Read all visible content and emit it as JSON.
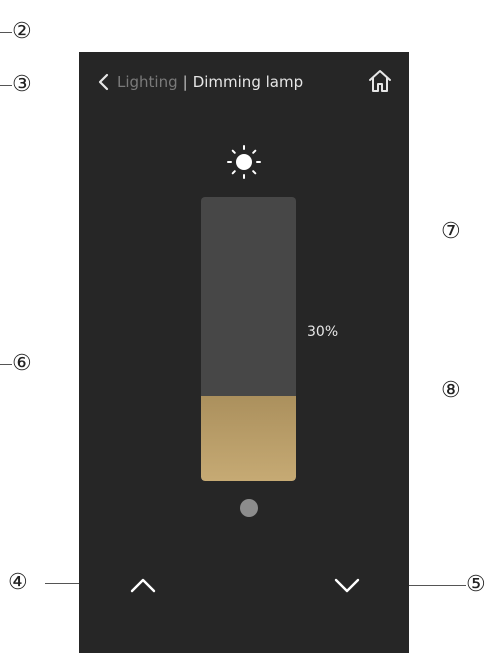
{
  "callouts": {
    "c2": "②",
    "c3": "③",
    "c4": "④",
    "c5": "⑤",
    "c6": "⑥",
    "c7": "⑦",
    "c8": "⑧"
  },
  "header": {
    "parent": "Lighting",
    "separator": "|",
    "title": "Dimming lamp"
  },
  "brightness": {
    "percent_label": "30%",
    "level": 0.3
  },
  "icons": {
    "back": "chevron-left-icon",
    "home": "home-icon",
    "brightness": "sun-icon",
    "increase": "chevron-up-icon",
    "decrease": "chevron-down-icon"
  },
  "colors": {
    "background": "#262626",
    "bar_track": "#474747",
    "bar_fill": "#b89d68",
    "indicator_dot": "#8c8c8c",
    "text": "#e6e6e6",
    "muted_text": "#7a7a7a"
  }
}
